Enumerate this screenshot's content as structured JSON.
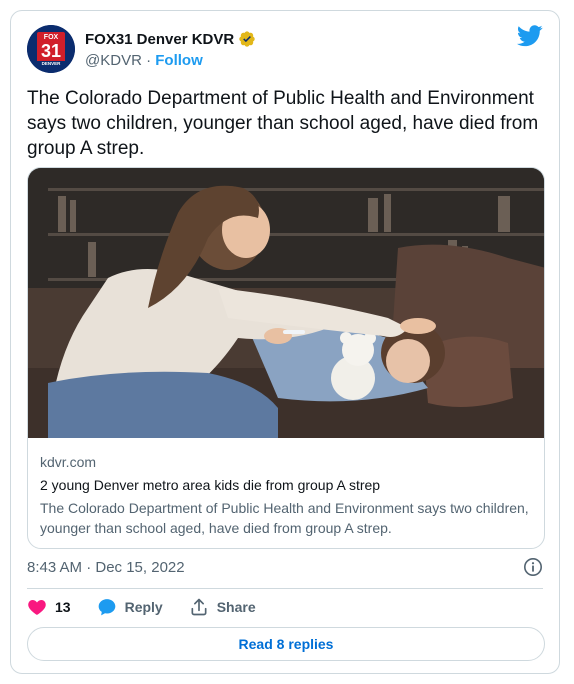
{
  "account": {
    "name": "FOX31 Denver KDVR",
    "handle": "@KDVR",
    "separator": "·",
    "follow_label": "Follow",
    "avatar_text": {
      "brand": "FOX",
      "number": "31",
      "city": "DENVER"
    }
  },
  "tweet": {
    "text": "The Colorado Department of Public Health and Environment says two children, younger than school aged, have died from group A strep."
  },
  "link_card": {
    "domain": "kdvr.com",
    "title": "2 young Denver metro area kids die from group A strep",
    "description": "The Colorado Department of Public Health and Environment says two children, younger than school aged, have died from group A strep."
  },
  "timestamp": "8:43 AM · Dec 15, 2022",
  "actions": {
    "like_count": "13",
    "reply_label": "Reply",
    "share_label": "Share"
  },
  "read_replies_label": "Read 8 replies",
  "colors": {
    "accent": "#1d9bf0",
    "like": "#f91880",
    "verified": "#e2b719",
    "link": "#006fd6"
  }
}
